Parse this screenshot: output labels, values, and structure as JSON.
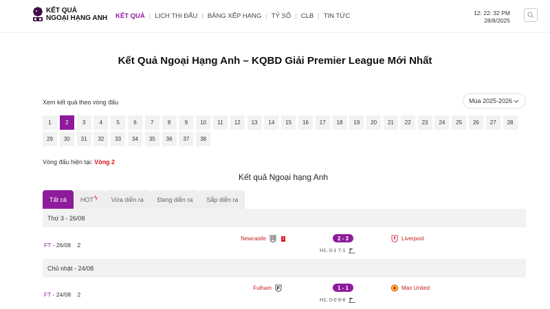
{
  "brand": {
    "line1": "KẾT QUẢ",
    "line2": "NGOẠI HẠNG ANH"
  },
  "nav": [
    "KẾT QUẢ",
    "LỊCH THI ĐẤU",
    "BẢNG XẾP HẠNG",
    "TỶ SỐ",
    "CLB",
    "TIN TỨC"
  ],
  "clock": {
    "time": "12: 22: 32 PM",
    "date": "28/8/2025"
  },
  "title": "Kết Quả Ngoại Hạng Anh – KQBD Giải Premier League Mới Nhất",
  "round_label": "Xem kết quả theo vòng đấu",
  "season": "Mùa 2025-2026",
  "rounds": [
    "1",
    "2",
    "3",
    "4",
    "5",
    "6",
    "7",
    "8",
    "9",
    "10",
    "11",
    "12",
    "13",
    "14",
    "15",
    "16",
    "17",
    "18",
    "19",
    "20",
    "21",
    "22",
    "23",
    "24",
    "25",
    "26",
    "27",
    "28",
    "29",
    "30",
    "31",
    "32",
    "33",
    "34",
    "35",
    "36",
    "37",
    "38"
  ],
  "active_round": "2",
  "current_round": {
    "label": "Vòng đấu hiện tại: ",
    "value": "Vòng 2"
  },
  "section_title": "Kết quả Ngoại hạng Anh",
  "tabs": {
    "all": "Tất cả",
    "hot": "HOT",
    "recent": "Vừa diễn ra",
    "live": "Đang diễn ra",
    "upcoming": "Sắp diễn ra"
  },
  "days": [
    {
      "label": "Thứ 3 - 26/08"
    },
    {
      "label": "Chủ nhật - 24/08"
    }
  ],
  "matches": [
    {
      "status": "FT",
      "date": "26/08",
      "round": "2",
      "home": "Newcastle",
      "away": "Liverpool",
      "score": "2 - 3",
      "half": "H1: 0-1  7-1",
      "home_red_card": "1"
    },
    {
      "status": "FT",
      "date": "24/08",
      "round": "2",
      "home": "Fulham",
      "away": "Man United",
      "score": "1 - 1",
      "half": "H1: 0-0  9-6"
    }
  ],
  "colors": {
    "accent": "#8e1b9b",
    "red": "#e0141e"
  }
}
